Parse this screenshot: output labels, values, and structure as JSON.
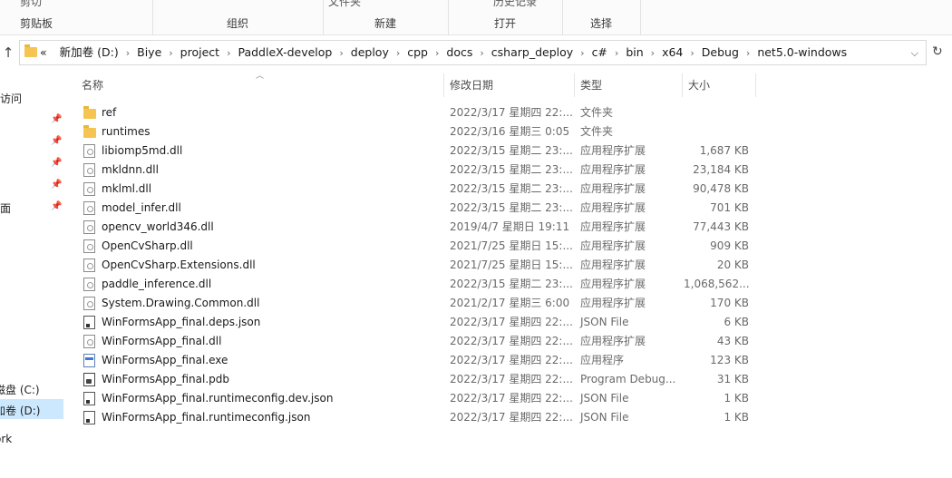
{
  "ribbon": {
    "groups": [
      {
        "label": "剪贴板",
        "cut_text": "剪切"
      },
      {
        "label": "组织",
        "cut_text": ""
      },
      {
        "label": "新建",
        "cut_text": "文件夹"
      },
      {
        "label": "打开",
        "cut_text": "历史记录"
      },
      {
        "label": "选择",
        "cut_text": ""
      }
    ]
  },
  "address": {
    "prefix": "«",
    "crumbs": [
      "新加卷 (D:)",
      "Biye",
      "project",
      "PaddleX-develop",
      "deploy",
      "cpp",
      "docs",
      "csharp_deploy",
      "c#",
      "bin",
      "x64",
      "Debug",
      "net5.0-windows"
    ]
  },
  "leftnav": {
    "items": [
      {
        "label": "访问"
      },
      {
        "label": "面"
      },
      {
        "label": "磁盘 (C:)"
      },
      {
        "label": "新加卷 (D:)"
      },
      {
        "label": "ork"
      }
    ]
  },
  "columns": {
    "name": "名称",
    "date": "修改日期",
    "type": "类型",
    "size": "大小"
  },
  "files": [
    {
      "name": "ref",
      "date": "2022/3/17 星期四 22:...",
      "type": "文件夹",
      "size": "",
      "icon": "folder"
    },
    {
      "name": "runtimes",
      "date": "2022/3/16 星期三 0:05",
      "type": "文件夹",
      "size": "",
      "icon": "folder"
    },
    {
      "name": "libiomp5md.dll",
      "date": "2022/3/15 星期二 23:...",
      "type": "应用程序扩展",
      "size": "1,687 KB",
      "icon": "file"
    },
    {
      "name": "mkldnn.dll",
      "date": "2022/3/15 星期二 23:...",
      "type": "应用程序扩展",
      "size": "23,184 KB",
      "icon": "file"
    },
    {
      "name": "mklml.dll",
      "date": "2022/3/15 星期二 23:...",
      "type": "应用程序扩展",
      "size": "90,478 KB",
      "icon": "file"
    },
    {
      "name": "model_infer.dll",
      "date": "2022/3/15 星期二 23:...",
      "type": "应用程序扩展",
      "size": "701 KB",
      "icon": "file"
    },
    {
      "name": "opencv_world346.dll",
      "date": "2019/4/7 星期日 19:11",
      "type": "应用程序扩展",
      "size": "77,443 KB",
      "icon": "file"
    },
    {
      "name": "OpenCvSharp.dll",
      "date": "2021/7/25 星期日 15:...",
      "type": "应用程序扩展",
      "size": "909 KB",
      "icon": "file"
    },
    {
      "name": "OpenCvSharp.Extensions.dll",
      "date": "2021/7/25 星期日 15:...",
      "type": "应用程序扩展",
      "size": "20 KB",
      "icon": "file"
    },
    {
      "name": "paddle_inference.dll",
      "date": "2022/3/15 星期二 23:...",
      "type": "应用程序扩展",
      "size": "1,068,562...",
      "icon": "file"
    },
    {
      "name": "System.Drawing.Common.dll",
      "date": "2021/2/17 星期三 6:00",
      "type": "应用程序扩展",
      "size": "170 KB",
      "icon": "file"
    },
    {
      "name": "WinFormsApp_final.deps.json",
      "date": "2022/3/17 星期四 22:...",
      "type": "JSON File",
      "size": "6 KB",
      "icon": "json"
    },
    {
      "name": "WinFormsApp_final.dll",
      "date": "2022/3/17 星期四 22:...",
      "type": "应用程序扩展",
      "size": "43 KB",
      "icon": "file"
    },
    {
      "name": "WinFormsApp_final.exe",
      "date": "2022/3/17 星期四 22:...",
      "type": "应用程序",
      "size": "123 KB",
      "icon": "exe"
    },
    {
      "name": "WinFormsApp_final.pdb",
      "date": "2022/3/17 星期四 22:...",
      "type": "Program Debug...",
      "size": "31 KB",
      "icon": "pdb"
    },
    {
      "name": "WinFormsApp_final.runtimeconfig.dev.json",
      "date": "2022/3/17 星期四 22:...",
      "type": "JSON File",
      "size": "1 KB",
      "icon": "json"
    },
    {
      "name": "WinFormsApp_final.runtimeconfig.json",
      "date": "2022/3/17 星期四 22:...",
      "type": "JSON File",
      "size": "1 KB",
      "icon": "json"
    }
  ]
}
